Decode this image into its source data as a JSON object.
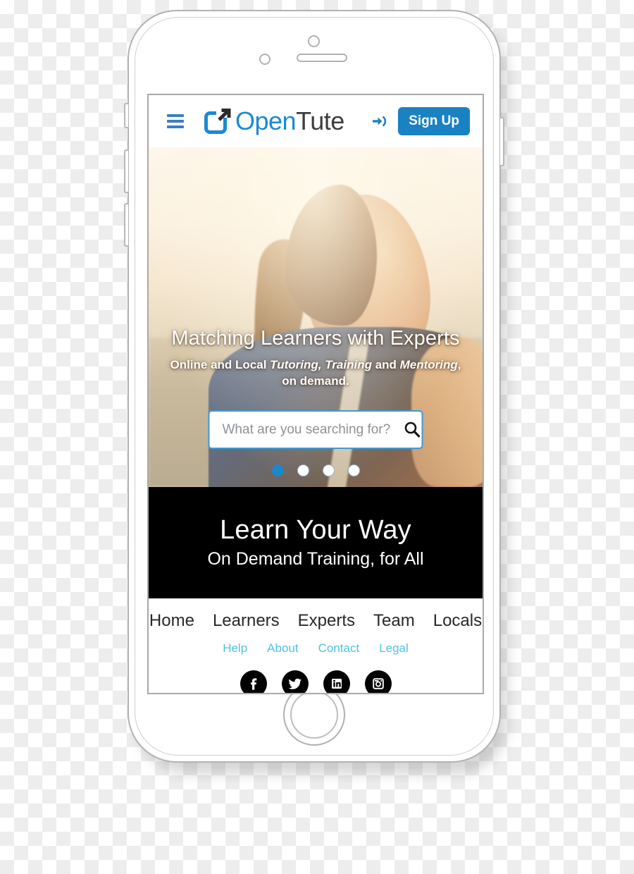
{
  "device": {
    "type": "smartphone-mockup",
    "camera": "camera-lens",
    "speaker": "earpiece-speaker",
    "home_button": "home-button"
  },
  "header": {
    "menu_icon": "hamburger-menu-icon",
    "brand": {
      "icon": "external-link-arrow-icon",
      "name_first": "Open",
      "name_second": "Tute",
      "color_primary": "#1a8ad4",
      "color_secondary": "#3d3d3d"
    },
    "signin_icon": "sign-in-arrow-icon",
    "signup_label": "Sign Up",
    "signup_color": "#1a82c3"
  },
  "hero": {
    "title": "Matching Learners with Experts",
    "subtitle_parts": [
      {
        "text": "Online and Local ",
        "italic": false
      },
      {
        "text": "Tutoring, Training",
        "italic": true
      },
      {
        "text": " and ",
        "italic": false
      },
      {
        "text": "Mentoring",
        "italic": true
      },
      {
        "text": ", on demand.",
        "italic": false
      }
    ],
    "subtitle_plain": "Online and Local Tutoring, Training and Mentoring, on demand.",
    "search": {
      "placeholder": "What are you searching for?",
      "value": "",
      "icon": "search-icon"
    },
    "carousel": {
      "total_slides": 4,
      "active_index": 0,
      "active_color": "#1f86c9",
      "inactive_color": "#ffffff"
    },
    "image_alt": "woman-in-profile-at-sunset-beach"
  },
  "promo": {
    "title": "Learn Your Way",
    "subtitle": "On Demand Training, for All",
    "background": "#000000"
  },
  "footer": {
    "primary_links": [
      {
        "label": "Home"
      },
      {
        "label": "Learners"
      },
      {
        "label": "Experts"
      },
      {
        "label": "Team"
      },
      {
        "label": "Locals"
      }
    ],
    "secondary_links": [
      {
        "label": "Help"
      },
      {
        "label": "About"
      },
      {
        "label": "Contact"
      },
      {
        "label": "Legal"
      }
    ],
    "secondary_color": "#4fc0e4",
    "social": [
      {
        "name": "facebook-icon",
        "label": "Facebook"
      },
      {
        "name": "twitter-icon",
        "label": "Twitter"
      },
      {
        "name": "linkedin-icon",
        "label": "LinkedIn"
      },
      {
        "name": "instagram-icon",
        "label": "Instagram"
      }
    ]
  }
}
